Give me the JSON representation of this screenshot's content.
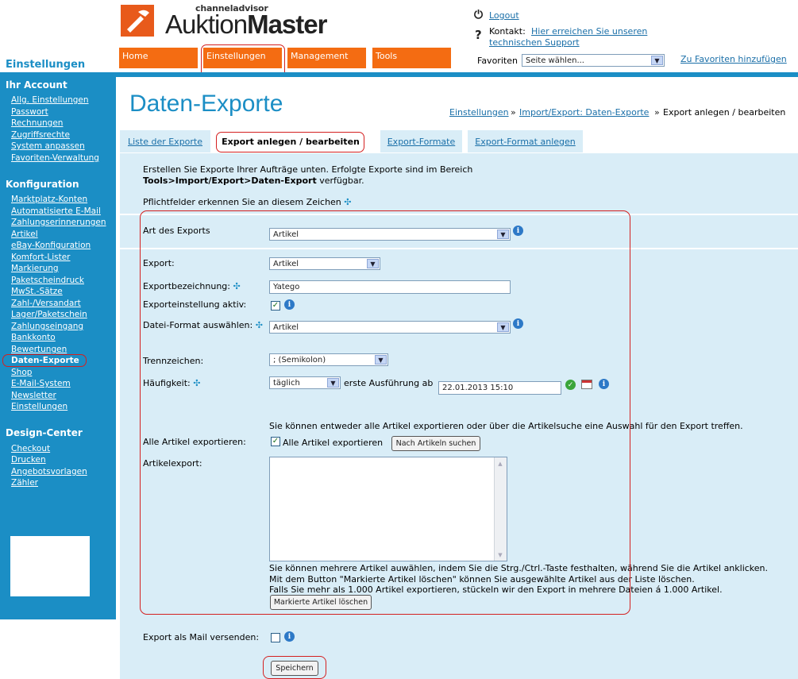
{
  "brand": {
    "small": "channeladvisor",
    "name_light": "Auktion",
    "name_bold": "Master"
  },
  "header": {
    "logout": "Logout",
    "kontakt_label": "Kontakt:",
    "kontakt_link1": "Hier erreichen Sie unseren",
    "kontakt_link2": "technischen Support",
    "favoriten_label": "Favoriten",
    "favoriten_select": "Seite wählen...",
    "favoriten_add": "Zu Favoriten hinzufügen"
  },
  "nav": {
    "home": "Home",
    "einstellungen": "Einstellungen",
    "management": "Management",
    "tools": "Tools"
  },
  "section_title": "Einstellungen",
  "sidebar": {
    "account_title": "Ihr Account",
    "account": [
      "Allg. Einstellungen",
      "Passwort",
      "Rechnungen",
      "Zugriffsrechte",
      "System anpassen",
      "Favoriten-Verwaltung"
    ],
    "config_title": "Konfiguration",
    "config": [
      "Marktplatz-Konten",
      "Automatisierte E-Mail",
      "Zahlungserinnerungen",
      "Artikel",
      "eBay-Konfiguration",
      "Komfort-Lister",
      "Markierung",
      "Paketscheindruck",
      "MwSt.-Sätze",
      "Zahl-/Versandart",
      "Lager/Paketschein",
      "Zahlungseingang",
      "Bankkonto",
      "Bewertungen",
      "Daten-Exporte",
      "Shop",
      "E-Mail-System",
      "Newsletter",
      "Einstellungen"
    ],
    "design_title": "Design-Center",
    "design": [
      "Checkout",
      "Drucken",
      "Angebotsvorlagen",
      "Zähler"
    ]
  },
  "page": {
    "title": "Daten-Exporte",
    "crumb1": "Einstellungen",
    "crumb_sep": "»",
    "crumb2": "Import/Export: Daten-Exporte",
    "crumb3": "Export anlegen / bearbeiten"
  },
  "tabs": {
    "list": "Liste der Exporte",
    "create": "Export anlegen / bearbeiten",
    "formats": "Export-Formate",
    "create_format": "Export-Format anlegen"
  },
  "intro": {
    "line1": "Erstellen Sie Exporte Ihrer Aufträge unten. Erfolgte Exporte sind im Bereich",
    "path": "Tools>Import/Export>Daten-Export",
    "suffix": " verfügbar.",
    "required_note": "Pflichtfelder erkennen Sie an diesem Zeichen"
  },
  "form": {
    "art_label": "Art des Exports",
    "art_value": "Artikel",
    "export_label": "Export:",
    "export_value": "Artikel",
    "name_label": "Exportbezeichnung:",
    "name_value": "Yatego",
    "active_label": "Exporteinstellung aktiv:",
    "format_label": "Datei-Format auswählen:",
    "format_value": "Artikel",
    "sep_label": "Trennzeichen:",
    "sep_value": "; (Semikolon)",
    "freq_label": "Häufigkeit:",
    "freq_value": "täglich",
    "first_run_label": "erste Ausführung ab",
    "first_run_value": "22.01.2013 15:10",
    "hint_all": "Sie können entweder alle Artikel exportieren oder über die Artikelsuche eine Auswahl für den Export treffen.",
    "all_label": "Alle Artikel exportieren:",
    "all_check_label": "Alle Artikel exportieren",
    "search_btn": "Nach Artikeln suchen",
    "artikelexport_label": "Artikelexport:",
    "note1": "Sie können mehrere Artikel auwählen, indem Sie die Strg./Ctrl.-Taste festhalten, während Sie die Artikel anklicken.",
    "note2": "Mit dem Button \"Markierte Artikel löschen\" können Sie ausgewählte Artikel aus der Liste löschen.",
    "note3": "Falls Sie mehr als 1.000 Artikel exportieren, stückeln wir den Export in mehrere Dateien á 1.000 Artikel.",
    "delete_btn": "Markierte Artikel löschen",
    "mail_label": "Export als Mail versenden:",
    "save_btn": "Speichern"
  },
  "icons": {
    "required": "required-mark-icon",
    "info": "info-icon",
    "logout": "power-icon",
    "help": "question-icon"
  },
  "colors": {
    "accent": "#1b8ec5",
    "nav": "#f46c12",
    "highlight": "#d42020"
  }
}
